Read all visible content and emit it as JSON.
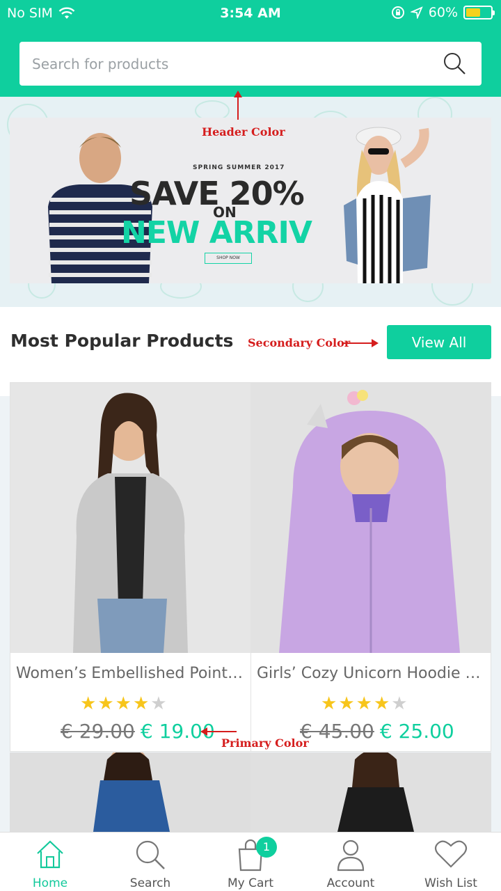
{
  "status_bar": {
    "carrier": "No SIM",
    "time": "3:54 AM",
    "battery": "60%",
    "battery_level": 0.6
  },
  "search": {
    "placeholder": "Search for products"
  },
  "banner": {
    "kicker": "SPRING SUMMER 2017",
    "headline": "SAVE 20%",
    "on": "ON",
    "subheadline": "NEW ARRIV",
    "cta": "SHOP NOW",
    "annotation": "Header Color"
  },
  "section": {
    "title": "Most Popular Products",
    "annotation": "Secondary Color",
    "view_all_label": "View All"
  },
  "products": [
    {
      "name": "Women’s Embellished Point…",
      "rating": 4,
      "old_price": "€ 29.00",
      "price": "€ 19.00"
    },
    {
      "name": "Girls’ Cozy Unicorn Hoodie –…",
      "rating": 4,
      "old_price": "€ 45.00",
      "price": "€ 25.00"
    }
  ],
  "price_annotation": "Primary Color",
  "tabbar": {
    "items": [
      {
        "label": "Home",
        "icon": "home-icon",
        "active": true
      },
      {
        "label": "Search",
        "icon": "search-icon"
      },
      {
        "label": "My Cart",
        "icon": "cart-icon"
      },
      {
        "label": "Account",
        "icon": "account-icon"
      },
      {
        "label": "Wish List",
        "icon": "heart-icon"
      }
    ],
    "cart_badge": "1"
  },
  "colors": {
    "header": "#0fcf9e",
    "secondary": "#0fcf9e",
    "primary": "#0fcf9e",
    "star": "#f7c51b",
    "annotation": "#d51d1d"
  }
}
